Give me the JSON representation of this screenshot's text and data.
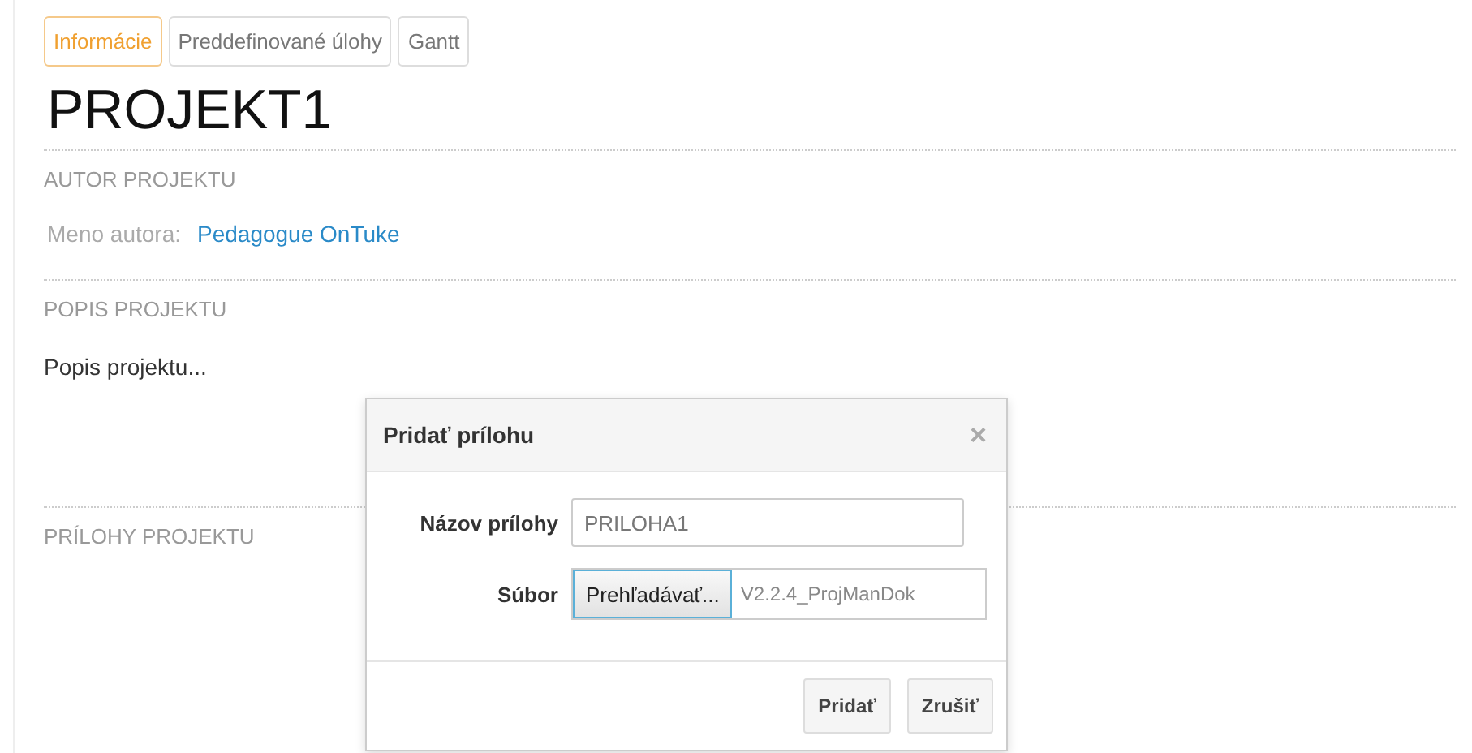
{
  "tabs": [
    {
      "label": "Informácie",
      "selected": true
    },
    {
      "label": "Preddefinované úlohy",
      "selected": false
    },
    {
      "label": "Gantt",
      "selected": false
    }
  ],
  "project_title": "PROJEKT1",
  "author_section": {
    "heading": "AUTOR PROJEKTU",
    "label": "Meno autora:",
    "author_link": "Pedagogue OnTuke"
  },
  "description_section": {
    "heading": "POPIS PROJEKTU",
    "text": "Popis projektu..."
  },
  "attachments_section": {
    "heading": "PRÍLOHY PROJEKTU"
  },
  "dialog": {
    "title": "Pridať prílohu",
    "close": "×",
    "name_field": {
      "label": "Názov prílohy",
      "value": "PRILOHA1"
    },
    "file_field": {
      "label": "Súbor",
      "browse_button": "Prehľadávať...",
      "file_name": "V2.2.4_ProjManDok"
    },
    "buttons": [
      "Pridať",
      "Zrušiť"
    ]
  }
}
